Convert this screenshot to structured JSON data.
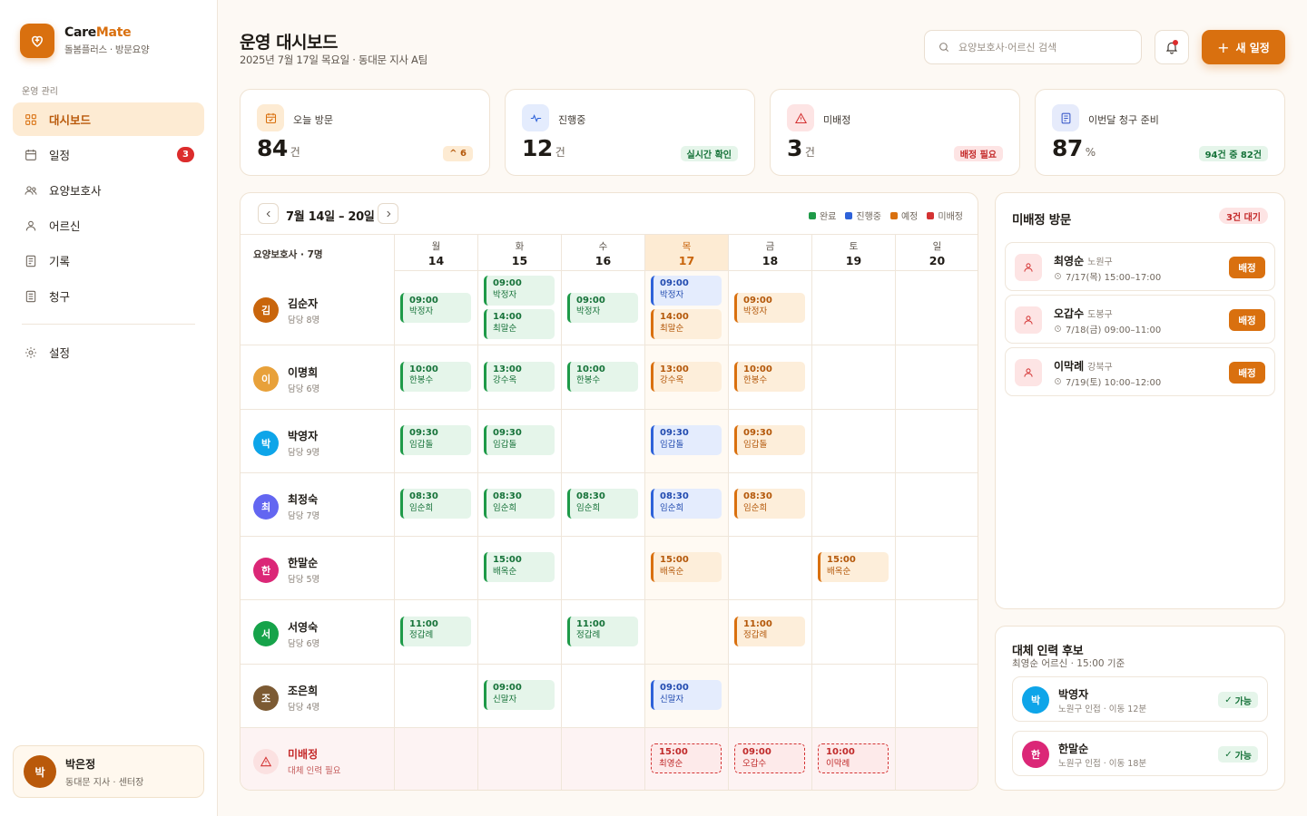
{
  "brand": {
    "name_part1": "Care",
    "name_part2": "Mate",
    "subtitle": "돌봄플러스 · 방문요양"
  },
  "nav": {
    "section_label": "운영 관리",
    "items": [
      {
        "label": "대시보드",
        "icon": "grid-icon",
        "active": true
      },
      {
        "label": "일정",
        "icon": "calendar-icon",
        "badge": "3"
      },
      {
        "label": "요양보호사",
        "icon": "users-icon"
      },
      {
        "label": "어르신",
        "icon": "user-icon"
      },
      {
        "label": "기록",
        "icon": "document-icon"
      },
      {
        "label": "청구",
        "icon": "invoice-icon"
      }
    ],
    "settings_label": "설정"
  },
  "profile": {
    "initial": "박",
    "name": "박은정",
    "role": "동대문 지사 · 센터장"
  },
  "header": {
    "title": "운영 대시보드",
    "subtitle": "2025년 7월 17일 목요일 · 동대문 지사 A팀",
    "search_placeholder": "요양보호사·어르신 검색",
    "new_button": "새 일정"
  },
  "stats": [
    {
      "label": "오늘 방문",
      "value": "84",
      "unit": "건",
      "chip": "^ 6",
      "color": "#d9700f"
    },
    {
      "label": "진행중",
      "value": "12",
      "unit": "건",
      "chip": "실시간 확인",
      "color": "#2e62d9"
    },
    {
      "label": "미배정",
      "value": "3",
      "unit": "건",
      "chip": "배정 필요",
      "color": "#d43333"
    },
    {
      "label": "이번달 청구 준비",
      "value": "87",
      "unit": "%",
      "chip": "94건 중 82건",
      "color": "#2e62d9"
    }
  ],
  "calendar": {
    "range": "7월 14일 – 20일",
    "legend": [
      "완료",
      "진행중",
      "예정",
      "미배정"
    ],
    "legend_colors": [
      "#1e9a48",
      "#2e62d9",
      "#d9700f",
      "#d43333"
    ],
    "caregiver_header": "요양보호사 · 7명",
    "days": [
      {
        "dow": "월",
        "num": "14"
      },
      {
        "dow": "화",
        "num": "15"
      },
      {
        "dow": "수",
        "num": "16"
      },
      {
        "dow": "목",
        "num": "17",
        "today": true
      },
      {
        "dow": "금",
        "num": "18"
      },
      {
        "dow": "토",
        "num": "19"
      },
      {
        "dow": "일",
        "num": "20"
      }
    ],
    "caregivers": [
      {
        "initial": "김",
        "name": "김순자",
        "load": "담당 8명",
        "color": "#c9650c"
      },
      {
        "initial": "이",
        "name": "이명희",
        "load": "담당 6명",
        "color": "#e8a13a"
      },
      {
        "initial": "박",
        "name": "박영자",
        "load": "담당 9명",
        "color": "#0ea5e9"
      },
      {
        "initial": "최",
        "name": "최정숙",
        "load": "담당 7명",
        "color": "#6366f1"
      },
      {
        "initial": "한",
        "name": "한말순",
        "load": "담당 5명",
        "color": "#db2777"
      },
      {
        "initial": "서",
        "name": "서영숙",
        "load": "담당 6명",
        "color": "#16a34a"
      },
      {
        "initial": "조",
        "name": "조은희",
        "load": "담당 4명",
        "color": "#7c5a33"
      }
    ],
    "unassigned_row": {
      "name": "미배정",
      "note": "대체 인력 필요"
    },
    "events": [
      {
        "row": 0,
        "day": 0,
        "slot": "single",
        "time": "09:00",
        "name": "박정자",
        "status": "done"
      },
      {
        "row": 0,
        "day": 1,
        "slot": "top",
        "time": "09:00",
        "name": "박정자",
        "status": "done"
      },
      {
        "row": 0,
        "day": 1,
        "slot": "bottom",
        "time": "14:00",
        "name": "최말순",
        "status": "done"
      },
      {
        "row": 0,
        "day": 2,
        "slot": "single",
        "time": "09:00",
        "name": "박정자",
        "status": "done"
      },
      {
        "row": 0,
        "day": 3,
        "slot": "top",
        "time": "09:00",
        "name": "박정자",
        "status": "progress"
      },
      {
        "row": 0,
        "day": 3,
        "slot": "bottom",
        "time": "14:00",
        "name": "최말순",
        "status": "planned"
      },
      {
        "row": 0,
        "day": 4,
        "slot": "single",
        "time": "09:00",
        "name": "박정자",
        "status": "planned"
      },
      {
        "row": 1,
        "day": 0,
        "slot": "single",
        "time": "10:00",
        "name": "한봉수",
        "status": "done"
      },
      {
        "row": 1,
        "day": 1,
        "slot": "single",
        "time": "13:00",
        "name": "강수옥",
        "status": "done"
      },
      {
        "row": 1,
        "day": 2,
        "slot": "single",
        "time": "10:00",
        "name": "한봉수",
        "status": "done"
      },
      {
        "row": 1,
        "day": 3,
        "slot": "single",
        "time": "13:00",
        "name": "강수옥",
        "status": "planned"
      },
      {
        "row": 1,
        "day": 4,
        "slot": "single",
        "time": "10:00",
        "name": "한봉수",
        "status": "planned"
      },
      {
        "row": 2,
        "day": 0,
        "slot": "single",
        "time": "09:30",
        "name": "임갑돌",
        "status": "done"
      },
      {
        "row": 2,
        "day": 1,
        "slot": "single",
        "time": "09:30",
        "name": "임갑돌",
        "status": "done"
      },
      {
        "row": 2,
        "day": 3,
        "slot": "single",
        "time": "09:30",
        "name": "임갑돌",
        "status": "progress"
      },
      {
        "row": 2,
        "day": 4,
        "slot": "single",
        "time": "09:30",
        "name": "임갑돌",
        "status": "planned"
      },
      {
        "row": 3,
        "day": 0,
        "slot": "single",
        "time": "08:30",
        "name": "임순희",
        "status": "done"
      },
      {
        "row": 3,
        "day": 1,
        "slot": "single",
        "time": "08:30",
        "name": "임순희",
        "status": "done"
      },
      {
        "row": 3,
        "day": 2,
        "slot": "single",
        "time": "08:30",
        "name": "임순희",
        "status": "done"
      },
      {
        "row": 3,
        "day": 3,
        "slot": "single",
        "time": "08:30",
        "name": "임순희",
        "status": "progress"
      },
      {
        "row": 3,
        "day": 4,
        "slot": "single",
        "time": "08:30",
        "name": "임순희",
        "status": "planned"
      },
      {
        "row": 4,
        "day": 1,
        "slot": "single",
        "time": "15:00",
        "name": "배옥순",
        "status": "done"
      },
      {
        "row": 4,
        "day": 3,
        "slot": "single",
        "time": "15:00",
        "name": "배옥순",
        "status": "planned"
      },
      {
        "row": 4,
        "day": 5,
        "slot": "single",
        "time": "15:00",
        "name": "배옥순",
        "status": "planned"
      },
      {
        "row": 5,
        "day": 0,
        "slot": "single",
        "time": "11:00",
        "name": "정갑례",
        "status": "done"
      },
      {
        "row": 5,
        "day": 2,
        "slot": "single",
        "time": "11:00",
        "name": "정갑례",
        "status": "done"
      },
      {
        "row": 5,
        "day": 4,
        "slot": "single",
        "time": "11:00",
        "name": "정갑례",
        "status": "planned"
      },
      {
        "row": 6,
        "day": 1,
        "slot": "single",
        "time": "09:00",
        "name": "신말자",
        "status": "done"
      },
      {
        "row": 6,
        "day": 3,
        "slot": "single",
        "time": "09:00",
        "name": "신말자",
        "status": "progress"
      },
      {
        "row": 7,
        "day": 3,
        "slot": "single",
        "time": "15:00",
        "name": "최영순",
        "status": "unassigned"
      },
      {
        "row": 7,
        "day": 4,
        "slot": "single",
        "time": "09:00",
        "name": "오갑수",
        "status": "unassigned"
      },
      {
        "row": 7,
        "day": 5,
        "slot": "single",
        "time": "10:00",
        "name": "이막례",
        "status": "unassigned"
      }
    ]
  },
  "unassigned_panel": {
    "title": "미배정 방문",
    "chip": "3건 대기",
    "assign_label": "배정",
    "items": [
      {
        "name": "최영순",
        "area": "노원구",
        "time": "7/17(목) 15:00–17:00"
      },
      {
        "name": "오갑수",
        "area": "도봉구",
        "time": "7/18(금) 09:00–11:00"
      },
      {
        "name": "이막례",
        "area": "강북구",
        "time": "7/19(토) 10:00–12:00"
      }
    ]
  },
  "substitute_panel": {
    "title": "대체 인력 후보",
    "subtitle": "최영순 어르신 · 15:00 기준",
    "candidates": [
      {
        "initial": "박",
        "name": "박영자",
        "meta": "노원구 인접 · 이동 12분",
        "chip": "가능",
        "color": "#0ea5e9"
      },
      {
        "initial": "한",
        "name": "한말순",
        "meta": "노원구 인접 · 이동 18분",
        "chip": "가능",
        "color": "#db2777"
      }
    ]
  }
}
